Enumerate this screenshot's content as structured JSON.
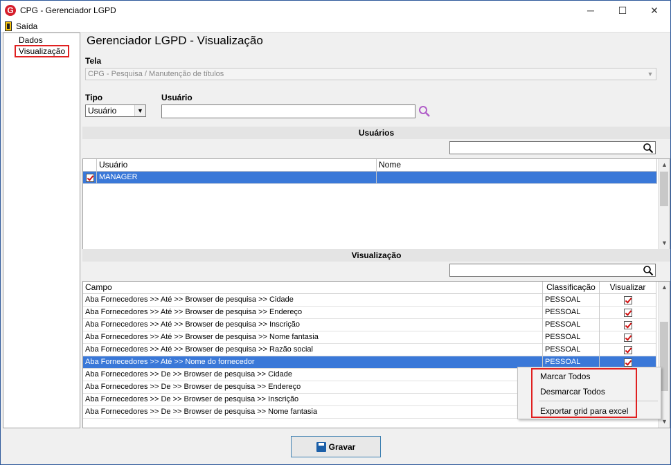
{
  "window": {
    "title": "CPG - Gerenciador LGPD",
    "minimize": "─",
    "maximize": "☐",
    "close": "✕"
  },
  "menu": {
    "exit_label": "Saída"
  },
  "tree": {
    "items": [
      "Dados",
      "Visualização"
    ],
    "selected": "Visualização"
  },
  "main": {
    "title": "Gerenciador LGPD - Visualização",
    "tela_label": "Tela",
    "tela_value": "CPG - Pesquisa / Manutenção de títulos",
    "tipo_label": "Tipo",
    "tipo_value": "Usuário",
    "usuario_label": "Usuário",
    "usuario_value": ""
  },
  "users_section": {
    "title": "Usuários",
    "filter_value": "",
    "columns": [
      "Usuário",
      "Nome"
    ],
    "rows": [
      {
        "checked": true,
        "usuario": "MANAGER",
        "nome": ""
      }
    ]
  },
  "view_section": {
    "title": "Visualização",
    "filter_value": "",
    "columns": [
      "Campo",
      "Classificação",
      "Visualizar"
    ],
    "rows": [
      {
        "campo": "Aba Fornecedores >> Até >> Browser de pesquisa >> Cidade",
        "classificacao": "PESSOAL",
        "visualizar": true
      },
      {
        "campo": "Aba Fornecedores >> Até >> Browser de pesquisa >> Endereço",
        "classificacao": "PESSOAL",
        "visualizar": true
      },
      {
        "campo": "Aba Fornecedores >> Até >> Browser de pesquisa >> Inscrição",
        "classificacao": "PESSOAL",
        "visualizar": true
      },
      {
        "campo": "Aba Fornecedores >> Até >> Browser de pesquisa >> Nome fantasia",
        "classificacao": "PESSOAL",
        "visualizar": true
      },
      {
        "campo": "Aba Fornecedores >> Até >> Browser de pesquisa >> Razão social",
        "classificacao": "PESSOAL",
        "visualizar": true
      },
      {
        "campo": "Aba Fornecedores >> Até >> Nome do fornecedor",
        "classificacao": "PESSOAL",
        "visualizar": true,
        "selected": true
      },
      {
        "campo": "Aba Fornecedores >> De >> Browser de pesquisa >> Cidade",
        "classificacao": "",
        "visualizar": false
      },
      {
        "campo": "Aba Fornecedores >> De >> Browser de pesquisa >> Endereço",
        "classificacao": "",
        "visualizar": false
      },
      {
        "campo": "Aba Fornecedores >> De >> Browser de pesquisa >> Inscrição",
        "classificacao": "",
        "visualizar": false
      },
      {
        "campo": "Aba Fornecedores >> De >> Browser de pesquisa >> Nome fantasia",
        "classificacao": "",
        "visualizar": false
      }
    ]
  },
  "context_menu": {
    "items": [
      "Marcar Todos",
      "Desmarcar Todos",
      "Exportar grid para excel"
    ]
  },
  "footer": {
    "save_label": "Gravar"
  }
}
